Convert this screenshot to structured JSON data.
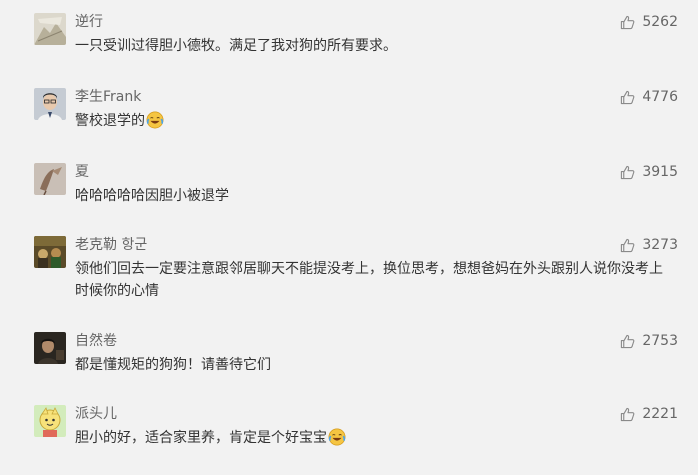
{
  "comments": [
    {
      "username": "逆行",
      "text": "一只受训过得胆小德牧。满足了我对狗的所有要求。",
      "likes": "5262",
      "emoji": "",
      "avatar_color": "#d9d4c4"
    },
    {
      "username": "李生Frank",
      "text": "警校退学的",
      "likes": "4776",
      "emoji": "laughing-crying-emoji",
      "avatar_color": "#b9c0c8"
    },
    {
      "username": "夏",
      "text": "哈哈哈哈哈因胆小被退学",
      "likes": "3915",
      "emoji": "",
      "avatar_color": "#b7aaa0"
    },
    {
      "username": "老克勒 항군",
      "text": "领他们回去一定要注意跟邻居聊天不能提没考上，换位思考，想想爸妈在外头跟别人说你没考上时候你的心情",
      "likes": "3273",
      "emoji": "",
      "avatar_color": "#6a5a30"
    },
    {
      "username": "自然卷",
      "text": "都是懂规矩的狗狗！请善待它们",
      "likes": "2753",
      "emoji": "",
      "avatar_color": "#2e2a24"
    },
    {
      "username": "派头儿",
      "text": "胆小的好，适合家里养，肯定是个好宝宝",
      "likes": "2221",
      "emoji": "laughing-crying-emoji",
      "avatar_color": "#c9e6b0"
    }
  ],
  "colors": {
    "background": "#f2f2f2",
    "username": "#666666",
    "text": "#333333",
    "like_icon": "#8a8a8a"
  }
}
